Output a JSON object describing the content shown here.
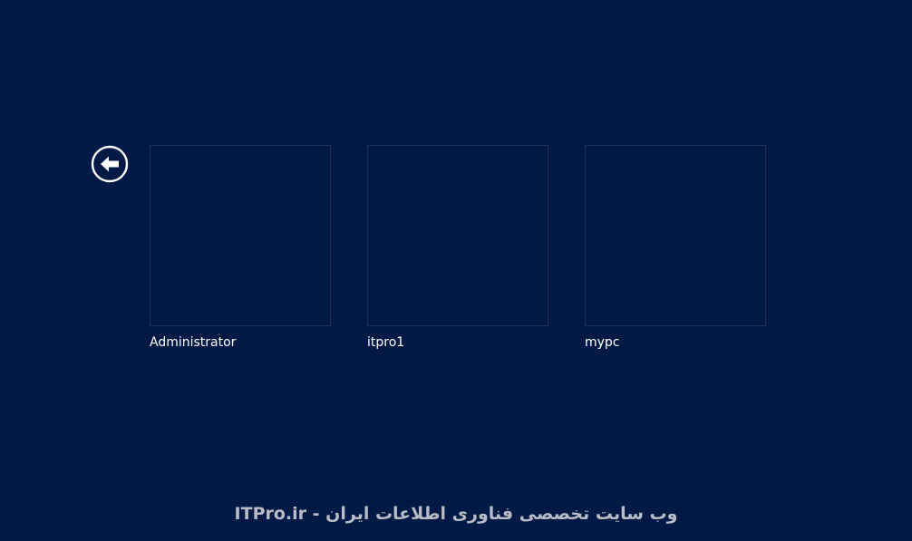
{
  "colors": {
    "background": "#001a45",
    "tile_border": "#1e2f5a",
    "label_text": "#ffffff",
    "icon": "#ffffff",
    "watermark_text": "#b8bcc6"
  },
  "back_button": {
    "icon": "back-arrow-circle-icon"
  },
  "accounts": [
    {
      "name": "Administrator"
    },
    {
      "name": "itpro1"
    },
    {
      "name": "mypc"
    }
  ],
  "watermark": {
    "text": "ITPro.ir - وب سایت تخصصی فناوری اطلاعات ایران"
  }
}
